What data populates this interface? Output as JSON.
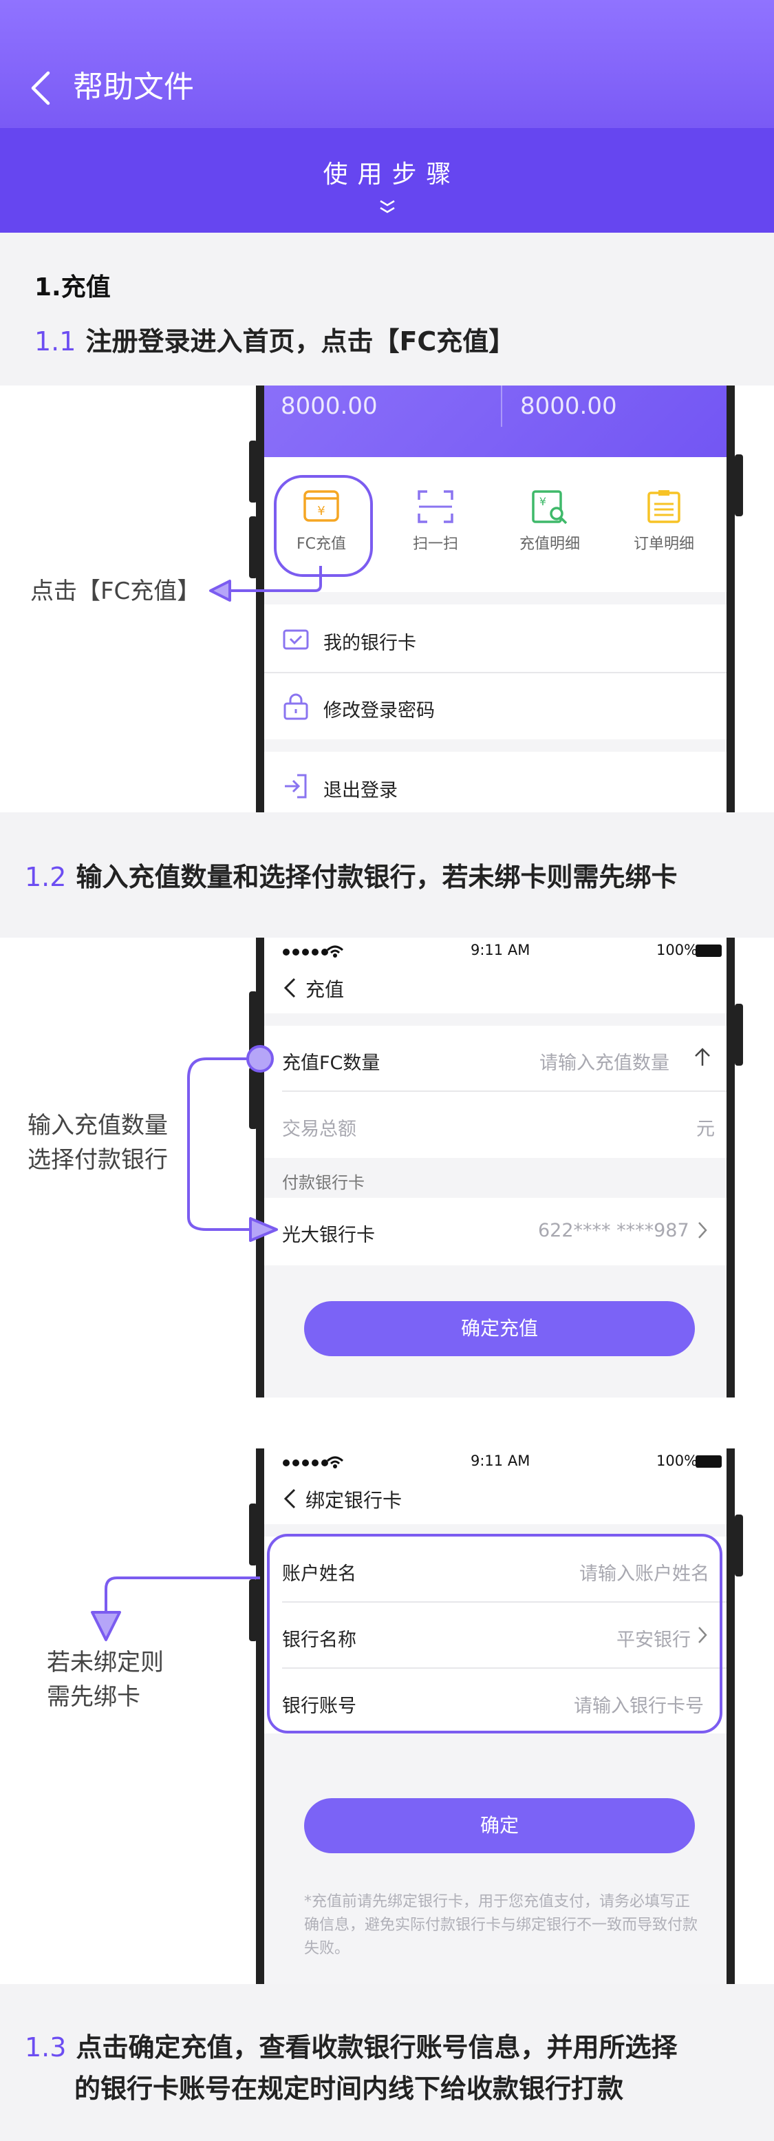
{
  "header": {
    "title": "帮助文件"
  },
  "steps_bar": {
    "title": "使用步骤"
  },
  "section": {
    "title": "1.充值"
  },
  "step_1_1": {
    "num": "1.1",
    "text": "注册登录进入首页，点击【FC充值】"
  },
  "home": {
    "balance_left": "8000.00",
    "balance_right": "8000.00",
    "actions": [
      {
        "label": "FC充值",
        "icon": "yen-card-icon",
        "color": "#f5a623"
      },
      {
        "label": "扫一扫",
        "icon": "scan-icon",
        "color": "#8a74f0"
      },
      {
        "label": "充值明细",
        "icon": "recharge-detail-icon",
        "color": "#3fb96a"
      },
      {
        "label": "订单明细",
        "icon": "order-detail-icon",
        "color": "#f7c326"
      }
    ],
    "menu": [
      "我的银行卡",
      "修改登录密码",
      "退出登录"
    ],
    "callout": "点击【FC充值】"
  },
  "step_1_2": {
    "num": "1.2",
    "text": "输入充值数量和选择付款银行，若未绑卡则需先绑卡"
  },
  "recharge": {
    "status_time": "9:11 AM",
    "battery": "100%",
    "title": "充值",
    "amount_label": "充值FC数量",
    "amount_placeholder": "请输入充值数量",
    "total_label": "交易总额",
    "total_unit": "元",
    "bank_section": "付款银行卡",
    "bank_name": "光大银行卡",
    "bank_number": "622**** ****987",
    "confirm": "确定充值",
    "callout_line1": "输入充值数量",
    "callout_line2": "选择付款银行"
  },
  "bind": {
    "status_time": "9:11 AM",
    "battery": "100%",
    "title": "绑定银行卡",
    "name_label": "账户姓名",
    "name_placeholder": "请输入账户姓名",
    "bank_label": "银行名称",
    "bank_value": "平安银行",
    "account_label": "银行账号",
    "account_placeholder": "请输入银行卡号",
    "confirm": "确定",
    "note": "*充值前请先绑定银行卡，用于您充值支付，请务必填写正确信息，避免实际付款银行卡与绑定银行不一致而导致付款失败。",
    "callout_line1": "若未绑定则",
    "callout_line2": "需先绑卡"
  },
  "step_1_3": {
    "num": "1.3",
    "line1": "点击确定充值，查看收款银行账号信息，并用所选择",
    "line2": "的银行卡账号在规定时间内线下给收款银行打款"
  },
  "colors": {
    "accent": "#6c4df2",
    "callout_stroke": "#7b5cf0",
    "callout_fill": "#b5a5f8"
  }
}
